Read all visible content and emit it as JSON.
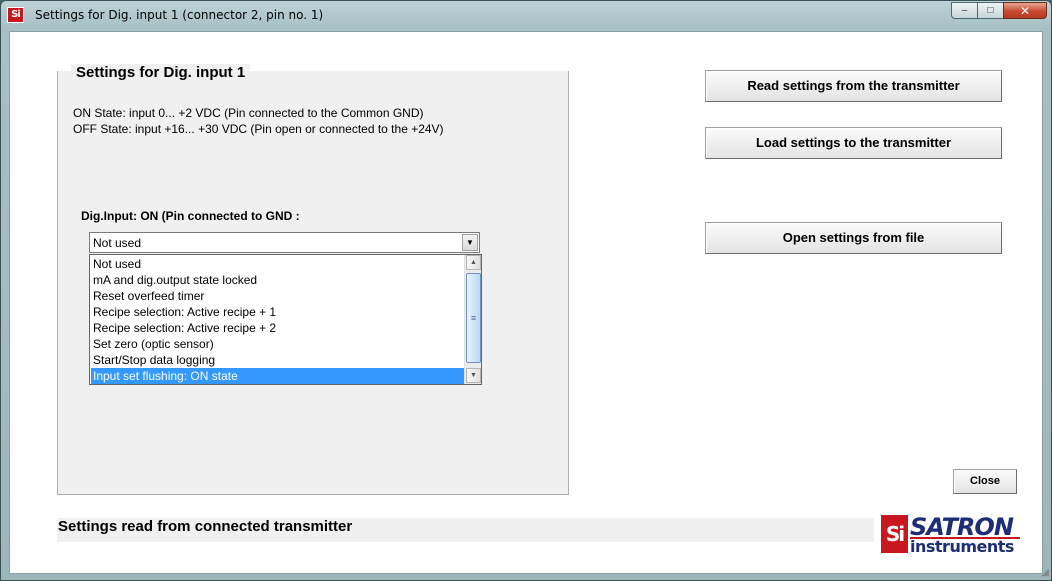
{
  "window": {
    "title": "Settings for Dig. input 1 (connector 2, pin no. 1)",
    "app_icon_text": "Si",
    "caption_minimize": "–",
    "caption_maximize": "□",
    "caption_close": "✕"
  },
  "group": {
    "title": "Settings for Dig. input 1",
    "on_state": "ON State: input 0... +2 VDC (Pin connected to the Common GND)",
    "off_state": "OFF State: input +16... +30 VDC (Pin open or connected to the +24V)",
    "dig_input_label": "Dig.Input: ON (Pin connected to GND :"
  },
  "combo": {
    "selected_value": "Not used",
    "arrow_glyph": "▼"
  },
  "listbox": {
    "items": [
      "Not used",
      "mA and dig.output state locked",
      "Reset overfeed timer",
      "Recipe selection: Active recipe + 1",
      "Recipe selection: Active recipe  + 2",
      "Set zero (optic sensor)",
      "Start/Stop data logging",
      "Input set flushing: ON state"
    ],
    "selected_index": 7,
    "scroll_up_glyph": "▲",
    "scroll_down_glyph": "▼",
    "thumb_grip": "≡"
  },
  "buttons": {
    "read": "Read settings from the transmitter",
    "load": "Load settings  to the transmitter",
    "open": "Open settings from file",
    "close": "Close"
  },
  "status": {
    "text": "Settings read from connected transmitter"
  },
  "logo": {
    "mark": "Si",
    "top": "SATRON",
    "bottom": "instruments"
  },
  "colors": {
    "selection": "#3399ff",
    "logo_red": "#c8171e",
    "logo_blue": "#1e2d78"
  }
}
